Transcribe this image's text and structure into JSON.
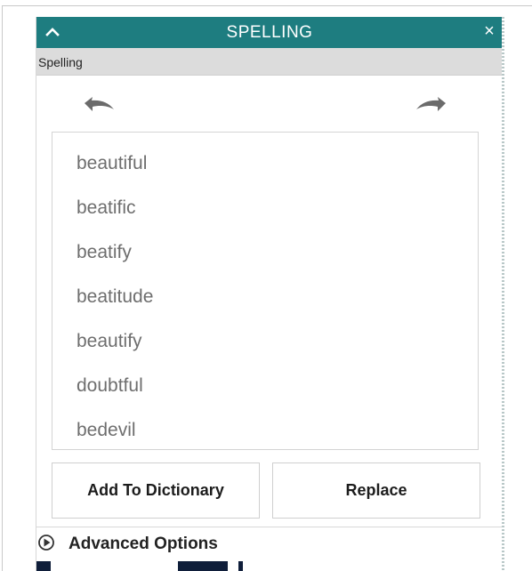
{
  "panel": {
    "title": "SPELLING",
    "close_glyph": "×",
    "section_label": "Spelling"
  },
  "icons": {
    "collapse": "chevron-up-icon",
    "close": "close-icon",
    "undo": "undo-arrow-icon",
    "redo": "redo-arrow-icon",
    "advanced": "play-circle-icon"
  },
  "suggestions": [
    "beautiful",
    "beatific",
    "beatify",
    "beatitude",
    "beautify",
    "doubtful",
    "bedevil"
  ],
  "buttons": {
    "add_to_dictionary": "Add To Dictionary",
    "replace": "Replace"
  },
  "advanced_options": {
    "label": "Advanced Options"
  },
  "colors": {
    "title_bar": "#1e7d80",
    "subheader": "#dcdcdc",
    "suggestion_text": "#6e6e6e"
  }
}
